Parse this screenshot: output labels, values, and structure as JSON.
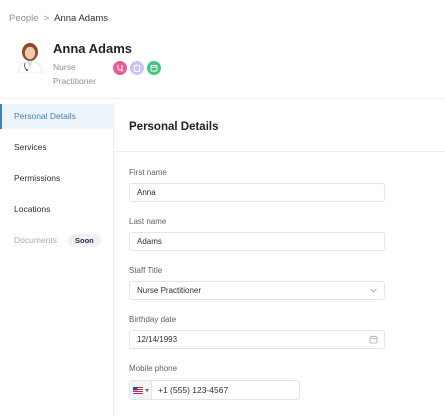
{
  "breadcrumb": {
    "parent": "People",
    "separator": ">",
    "current": "Anna Adams"
  },
  "profile": {
    "name": "Anna Adams",
    "role_line1": "Nurse",
    "role_line2": "Practitioner",
    "badges": [
      {
        "icon": "stethoscope-icon",
        "color": "#ea5f95"
      },
      {
        "icon": "clipboard-icon",
        "color": "#c7c5f4"
      },
      {
        "icon": "calendar-icon",
        "color": "#45c47e"
      }
    ]
  },
  "sidebar": {
    "items": [
      {
        "label": "Personal Details",
        "active": true
      },
      {
        "label": "Services"
      },
      {
        "label": "Permissions"
      },
      {
        "label": "Locations"
      },
      {
        "label": "Documents",
        "disabled": true,
        "badge": "Soon"
      }
    ]
  },
  "main": {
    "title": "Personal Details",
    "fields": {
      "first_name": {
        "label": "First name",
        "value": "Anna"
      },
      "last_name": {
        "label": "Last name",
        "value": "Adams"
      },
      "staff_title": {
        "label": "Staff Title",
        "value": "Nurse Practitioner"
      },
      "birthday": {
        "label": "Birthday date",
        "value": "12/14/1993"
      },
      "mobile": {
        "label": "Mobile phone",
        "value": "+1 (555) 123-4567",
        "country_icon": "us-flag-icon"
      }
    }
  },
  "colors": {
    "accent": "#3b82c4",
    "active_bg": "#eef4fb",
    "border": "#e1e4ea"
  }
}
